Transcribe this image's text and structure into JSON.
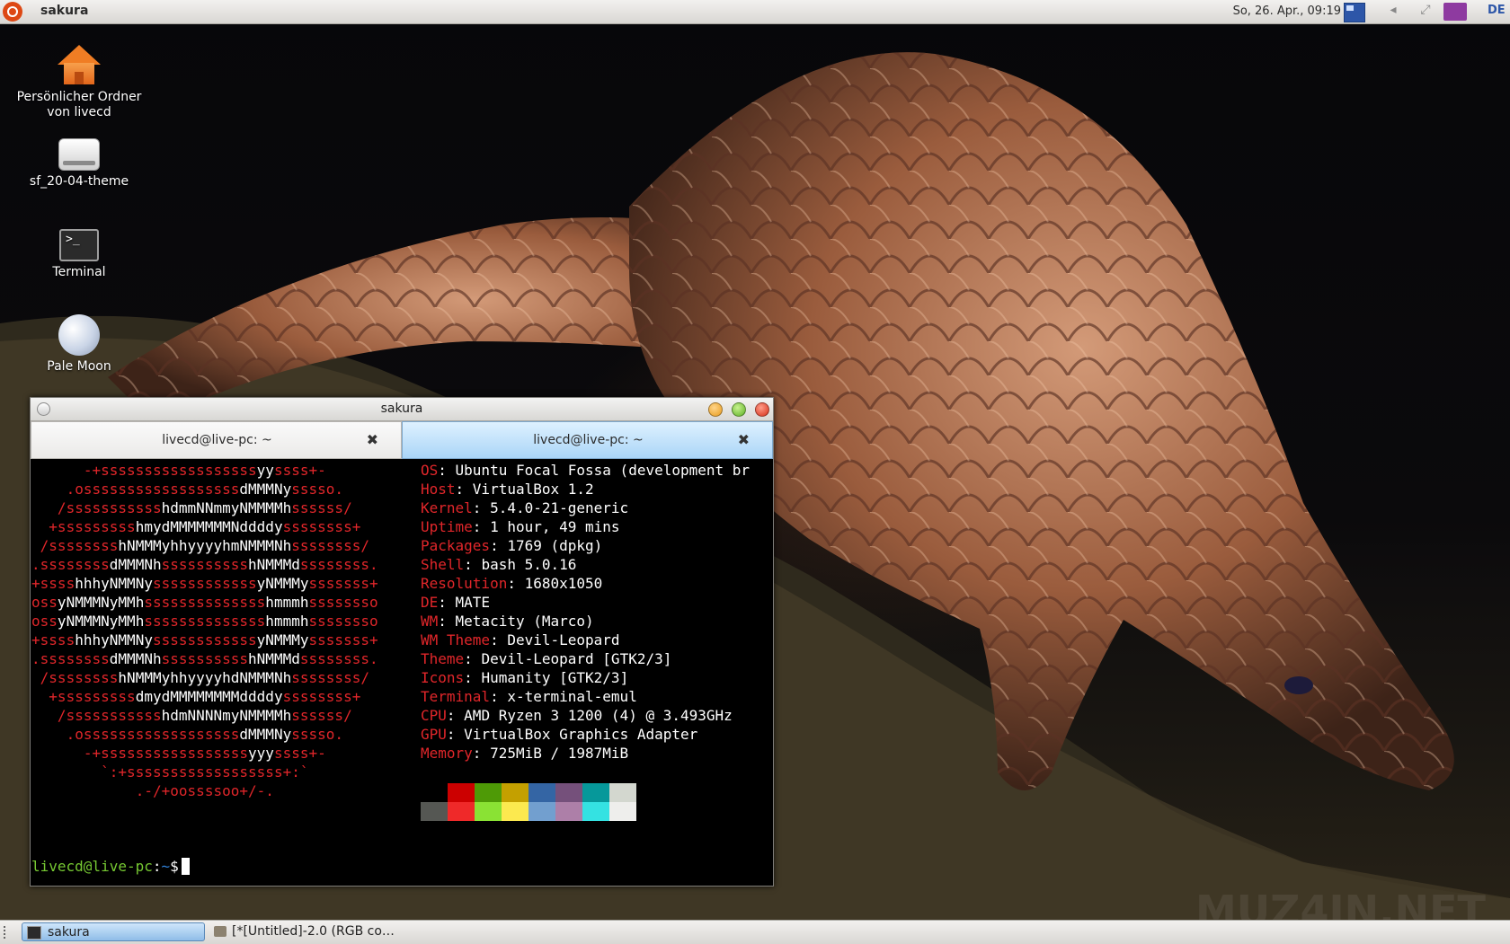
{
  "top_panel": {
    "app_title": "sakura",
    "clock": "So, 26. Apr., 09:19",
    "keyboard_layout": "DE"
  },
  "desktop_icons": [
    {
      "label": "Persönlicher Ordner von livecd",
      "icon": "home-folder-icon"
    },
    {
      "label": "sf_20-04-theme",
      "icon": "drive-icon"
    },
    {
      "label": "Terminal",
      "icon": "terminal-icon"
    },
    {
      "label": "Pale Moon",
      "icon": "pale-moon-icon"
    }
  ],
  "window": {
    "title": "sakura",
    "tabs": [
      {
        "label": "livecd@live-pc: ~",
        "active": false
      },
      {
        "label": "livecd@live-pc: ~",
        "active": true
      }
    ],
    "tab_close_glyph": "✖"
  },
  "terminal": {
    "logo_lines": [
      "      -+ssssssssssssssssssyyssss+-",
      "    .ossssssssssssssssssdMMMNysssso.",
      "   /ssssssssssshdmmNNmmyNMMMMhssssss/",
      "  +ssssssssshmydMMMMMMMNddddyssssssss+",
      " /sssssssshNMMMyhhyyyyhmNMMMNhssssssss/",
      ".ssssssssdMMMNhsssssssssshNMMMdssssssss.",
      "+sssshhhyNMMNyssssssssssssyNMMMysssssss+",
      "ossyNMMMNyMMhsssssssssssssshmmmhssssssso",
      "ossyNMMMNyMMhsssssssssssssshmmmhssssssso",
      "+sssshhhyNMMNyssssssssssssyNMMMysssssss+",
      ".ssssssssdMMMNhsssssssssshNMMMdssssssss.",
      " /sssssssshNMMMyhhyyyyhdNMMMNhssssssss/",
      "  +sssssssssdmydMMMMMMMMddddyssssssss+",
      "   /ssssssssssshdmNNNNmyNMMMMhssssss/",
      "    .ossssssssssssssssssdMMMNysssso.",
      "      -+sssssssssssssssssyyyssss+-",
      "        `:+ssssssssssssssssss+:`",
      "            .-/+oossssoo+/-."
    ],
    "info": [
      {
        "key": "OS",
        "value": "Ubuntu Focal Fossa (development br"
      },
      {
        "key": "Host",
        "value": "VirtualBox 1.2"
      },
      {
        "key": "Kernel",
        "value": "5.4.0-21-generic"
      },
      {
        "key": "Uptime",
        "value": "1 hour, 49 mins"
      },
      {
        "key": "Packages",
        "value": "1769 (dpkg)"
      },
      {
        "key": "Shell",
        "value": "bash 5.0.16"
      },
      {
        "key": "Resolution",
        "value": "1680x1050"
      },
      {
        "key": "DE",
        "value": "MATE"
      },
      {
        "key": "WM",
        "value": "Metacity (Marco)"
      },
      {
        "key": "WM Theme",
        "value": "Devil-Leopard"
      },
      {
        "key": "Theme",
        "value": "Devil-Leopard [GTK2/3]"
      },
      {
        "key": "Icons",
        "value": "Humanity [GTK2/3]"
      },
      {
        "key": "Terminal",
        "value": "x-terminal-emul"
      },
      {
        "key": "CPU",
        "value": "AMD Ryzen 3 1200 (4) @ 3.493GHz"
      },
      {
        "key": "GPU",
        "value": "VirtualBox Graphics Adapter"
      },
      {
        "key": "Memory",
        "value": "725MiB / 1987MiB"
      }
    ],
    "palette_top": [
      "#000000",
      "#cc0000",
      "#4e9a06",
      "#c4a000",
      "#3465a4",
      "#75507b",
      "#06989a",
      "#d3d7cf"
    ],
    "palette_bottom": [
      "#555753",
      "#ef2929",
      "#8ae234",
      "#fce94f",
      "#729fcf",
      "#ad7fa8",
      "#34e2e2",
      "#eeeeec"
    ],
    "prompt_user": "livecd@live-pc",
    "prompt_sep": ":",
    "prompt_path": "~",
    "prompt_symbol": "$"
  },
  "taskbar": {
    "items": [
      {
        "label": "sakura",
        "active": true
      },
      {
        "label": "[*[Untitled]-2.0 (RGB co…",
        "active": false
      }
    ]
  },
  "colors": {
    "logo_red": "#e0262a",
    "prompt_green": "#76c832",
    "prompt_blue": "#2f7fd6",
    "active_tab": "#aad5f7"
  }
}
